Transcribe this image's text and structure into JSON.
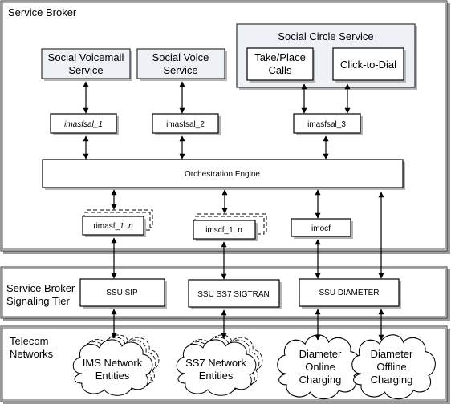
{
  "diagram": {
    "tiers": {
      "service_broker": {
        "label": "Service Broker"
      },
      "signaling_tier": {
        "label_line1": "Service Broker",
        "label_line2": "Signaling Tier"
      },
      "telecom_networks": {
        "label_line1": "Telecom",
        "label_line2": "Networks"
      }
    },
    "services": {
      "social_voicemail": {
        "line1": "Social Voicemail",
        "line2": "Service"
      },
      "social_voice": {
        "line1": "Social Voice",
        "line2": "Service"
      },
      "social_circle": {
        "title": "Social Circle Service",
        "take_place_calls": {
          "line1": "Take/Place",
          "line2": "Calls"
        },
        "click_to_dial": "Click-to-Dial"
      }
    },
    "adapters": {
      "imasfsal_1": "imasfsal_1",
      "imasfsal_2": "imasfsal_2",
      "imasfsal_3": "imasfsal_3"
    },
    "orchestration_engine": "Orchestration Engine",
    "interfaces": {
      "rimasf": {
        "prefix": "rimasf_",
        "italic_part": "1..n"
      },
      "imscf": "imscf_1..n",
      "imocf": "imocf"
    },
    "ssu": {
      "sip": "SSU SIP",
      "ss7": "SSU SS7 SIGTRAN",
      "diameter": "SSU DIAMETER"
    },
    "networks": {
      "ims": {
        "line1": "IMS Network",
        "line2": "Entities",
        "multiple": true
      },
      "ss7": {
        "line1": "SS7 Network",
        "line2": "Entities",
        "multiple": true
      },
      "online_charging": {
        "line1": "Diameter",
        "line2": "Online",
        "line3": "Charging"
      },
      "offline_charging": {
        "line1": "Diameter",
        "line2": "Offline",
        "line3": "Charging"
      }
    }
  }
}
